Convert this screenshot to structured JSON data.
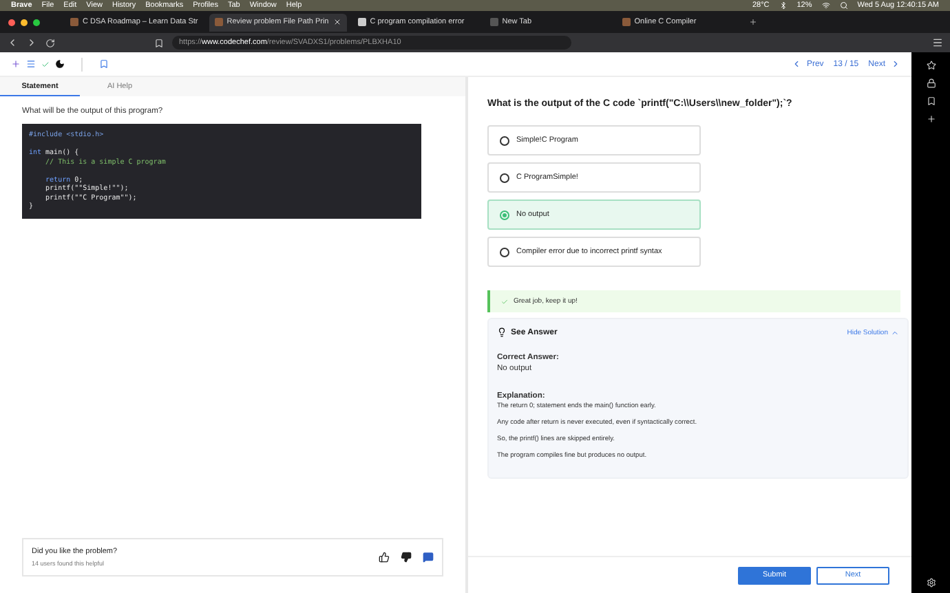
{
  "menu_bar": {
    "items": [
      "Brave",
      "File",
      "Edit",
      "View",
      "History",
      "Bookmarks",
      "Profiles",
      "Tab",
      "Window",
      "Help"
    ],
    "weather": "28°C",
    "battery": "12%",
    "clock": "Wed 5 Aug  12:40:15 AM"
  },
  "browser_tabs": [
    {
      "title": "C DSA Roadmap – Learn Data Str",
      "selected": false,
      "kind": "site"
    },
    {
      "title": "Review problem File Path Prin",
      "selected": true,
      "kind": "site"
    },
    {
      "title": "C program compilation error",
      "selected": false,
      "kind": "chat"
    },
    {
      "title": "New Tab",
      "selected": false,
      "kind": "newtab"
    },
    {
      "title": "Online C Compiler",
      "selected": false,
      "kind": "site"
    }
  ],
  "address": "https://**www.codechef.com**/review/SVADXS1/problems/PLBXHA10",
  "pager": {
    "prev": "Prev",
    "count": "13 / 15",
    "next": "Next"
  },
  "tabs": [
    {
      "label": "Statement",
      "selected": true
    },
    {
      "label": "AI Help",
      "selected": false
    }
  ],
  "question": "What will be the output of this program?",
  "code": [
    {
      "kind": "text",
      "segments": [
        {
          "text": "#include <stdio.h>",
          "kind": "directive"
        }
      ]
    },
    {
      "kind": "blank"
    },
    {
      "kind": "text",
      "segments": [
        {
          "text": "int",
          "kind": "keyword"
        },
        {
          "text": " main() {",
          "kind": "plain"
        }
      ]
    },
    {
      "kind": "text",
      "segments": [
        {
          "text": "    // This is a simple C program",
          "kind": "comment"
        }
      ]
    },
    {
      "kind": "blank"
    },
    {
      "kind": "text",
      "segments": [
        {
          "text": "    return",
          "kind": "keyword"
        },
        {
          "text": " 0;",
          "kind": "plain"
        }
      ]
    },
    {
      "kind": "text",
      "segments": [
        {
          "text": "    printf(\"\"Simple!\"\");",
          "kind": "plain"
        }
      ]
    },
    {
      "kind": "text",
      "segments": [
        {
          "text": "    printf(\"\"C Program\"\");",
          "kind": "plain"
        }
      ]
    },
    {
      "kind": "text",
      "segments": [
        {
          "text": "}",
          "kind": "plain"
        }
      ]
    }
  ],
  "feedback": {
    "prompt": "Did you like the problem?",
    "count": "14 users found this helpful"
  },
  "title": "What is the output of the C code `printf(\"C:\\\\Users\\\\new_folder\");`?",
  "options": [
    {
      "label": "Simple!C Program",
      "selected": false
    },
    {
      "label": "C ProgramSimple!",
      "selected": false
    },
    {
      "label": "No output",
      "selected": true
    },
    {
      "label": "Compiler error due to incorrect printf syntax",
      "selected": false
    }
  ],
  "result": "Great job, keep it up!",
  "answer": {
    "title": "See Answer",
    "toggle": "Hide Solution",
    "correct_label": "Correct Answer:",
    "correct_value": "No output",
    "explanation_label": "Explanation:",
    "explanation": [
      "The return 0; statement ends the main() function early.",
      "Any code after return is never executed, even if syntactically correct.",
      "So, the printf() lines are skipped entirely.",
      "The program compiles fine but produces no output."
    ]
  },
  "buttons": {
    "submit": "Submit",
    "next": "Next"
  }
}
